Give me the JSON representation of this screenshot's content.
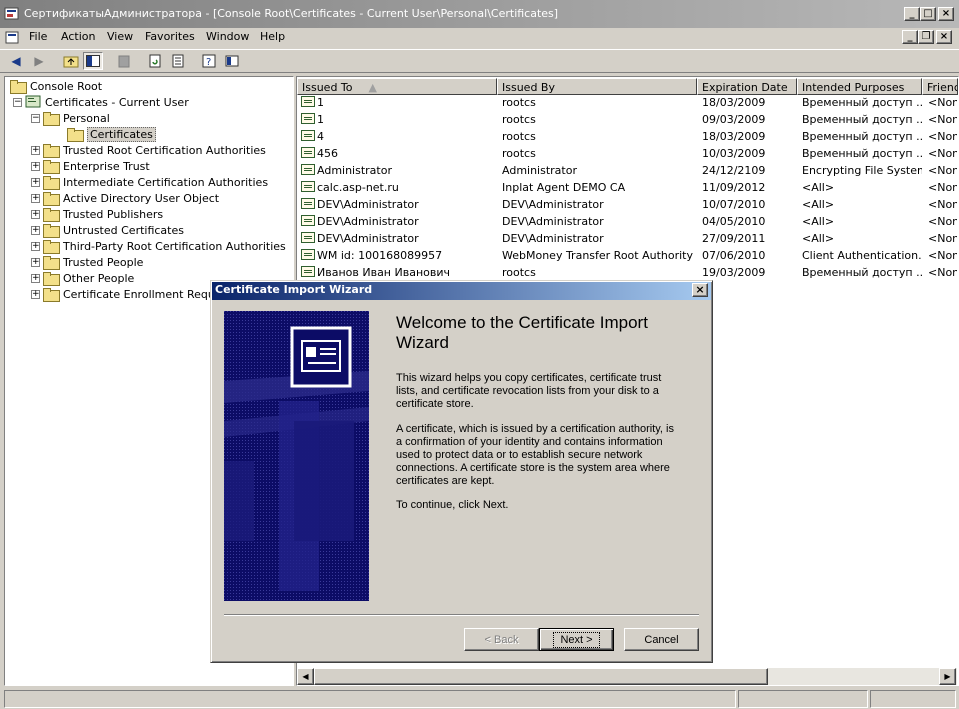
{
  "window": {
    "title": "СертификатыАдминистратора - [Console Root\\Certificates - Current User\\Personal\\Certificates]"
  },
  "menu": [
    {
      "label": "File"
    },
    {
      "label": "Action"
    },
    {
      "label": "View"
    },
    {
      "label": "Favorites"
    },
    {
      "label": "Window"
    },
    {
      "label": "Help"
    }
  ],
  "toolbar": {
    "icons": [
      "back-icon",
      "forward-icon",
      "up-folder-icon",
      "show-hide-tree-icon",
      "delete-icon",
      "refresh-icon",
      "export-list-icon",
      "help-icon",
      "properties-icon"
    ]
  },
  "tree": {
    "root": "Console Root",
    "store": "Certificates - Current User",
    "personal": "Personal",
    "certificates": "Certificates",
    "folders": [
      "Trusted Root Certification Authorities",
      "Enterprise Trust",
      "Intermediate Certification Authorities",
      "Active Directory User Object",
      "Trusted Publishers",
      "Untrusted Certificates",
      "Third-Party Root Certification Authorities",
      "Trusted People",
      "Other People",
      "Certificate Enrollment Reques"
    ]
  },
  "list": {
    "columns": [
      "Issued To",
      "Issued By",
      "Expiration Date",
      "Intended Purposes",
      "Frienc"
    ],
    "rows": [
      [
        "1",
        "rootcs",
        "18/03/2009",
        "Временный доступ ...",
        "<Non"
      ],
      [
        "1",
        "rootcs",
        "09/03/2009",
        "Временный доступ ...",
        "<Non"
      ],
      [
        "4",
        "rootcs",
        "18/03/2009",
        "Временный доступ ...",
        "<Non"
      ],
      [
        "456",
        "rootcs",
        "10/03/2009",
        "Временный доступ ...",
        "<Non"
      ],
      [
        "Administrator",
        "Administrator",
        "24/12/2109",
        "Encrypting File System",
        "<Non"
      ],
      [
        "calc.asp-net.ru",
        "Inplat Agent DEMO CA",
        "11/09/2012",
        "<All>",
        "<Non"
      ],
      [
        "DEV\\Administrator",
        "DEV\\Administrator",
        "10/07/2010",
        "<All>",
        "<Non"
      ],
      [
        "DEV\\Administrator",
        "DEV\\Administrator",
        "04/05/2010",
        "<All>",
        "<Non"
      ],
      [
        "DEV\\Administrator",
        "DEV\\Administrator",
        "27/09/2011",
        "<All>",
        "<Non"
      ],
      [
        "WM id: 100168089957",
        "WebMoney Transfer Root Authority",
        "07/06/2010",
        "Client Authentication...",
        "<Non"
      ],
      [
        "Иванов Иван Иванович",
        "rootcs",
        "19/03/2009",
        "Временный доступ ...",
        "<Non"
      ]
    ]
  },
  "dialog": {
    "title": "Certificate Import Wizard",
    "heading": "Welcome to the Certificate Import Wizard",
    "para1": "This wizard helps you copy certificates, certificate trust lists, and certificate revocation lists from your disk to a certificate store.",
    "para2": "A certificate, which is issued by a certification authority, is a confirmation of your identity and contains information used to protect data or to establish secure network connections. A certificate store is the system area where certificates are kept.",
    "para3": "To continue, click Next.",
    "back_label": "< Back",
    "next_label": "Next >",
    "cancel_label": "Cancel"
  },
  "colors": {
    "dialog_title_start": "#0a246a",
    "dialog_title_end": "#a6caf0",
    "wizard_banner": "#0c0c66",
    "inactive_title": "#808080"
  }
}
